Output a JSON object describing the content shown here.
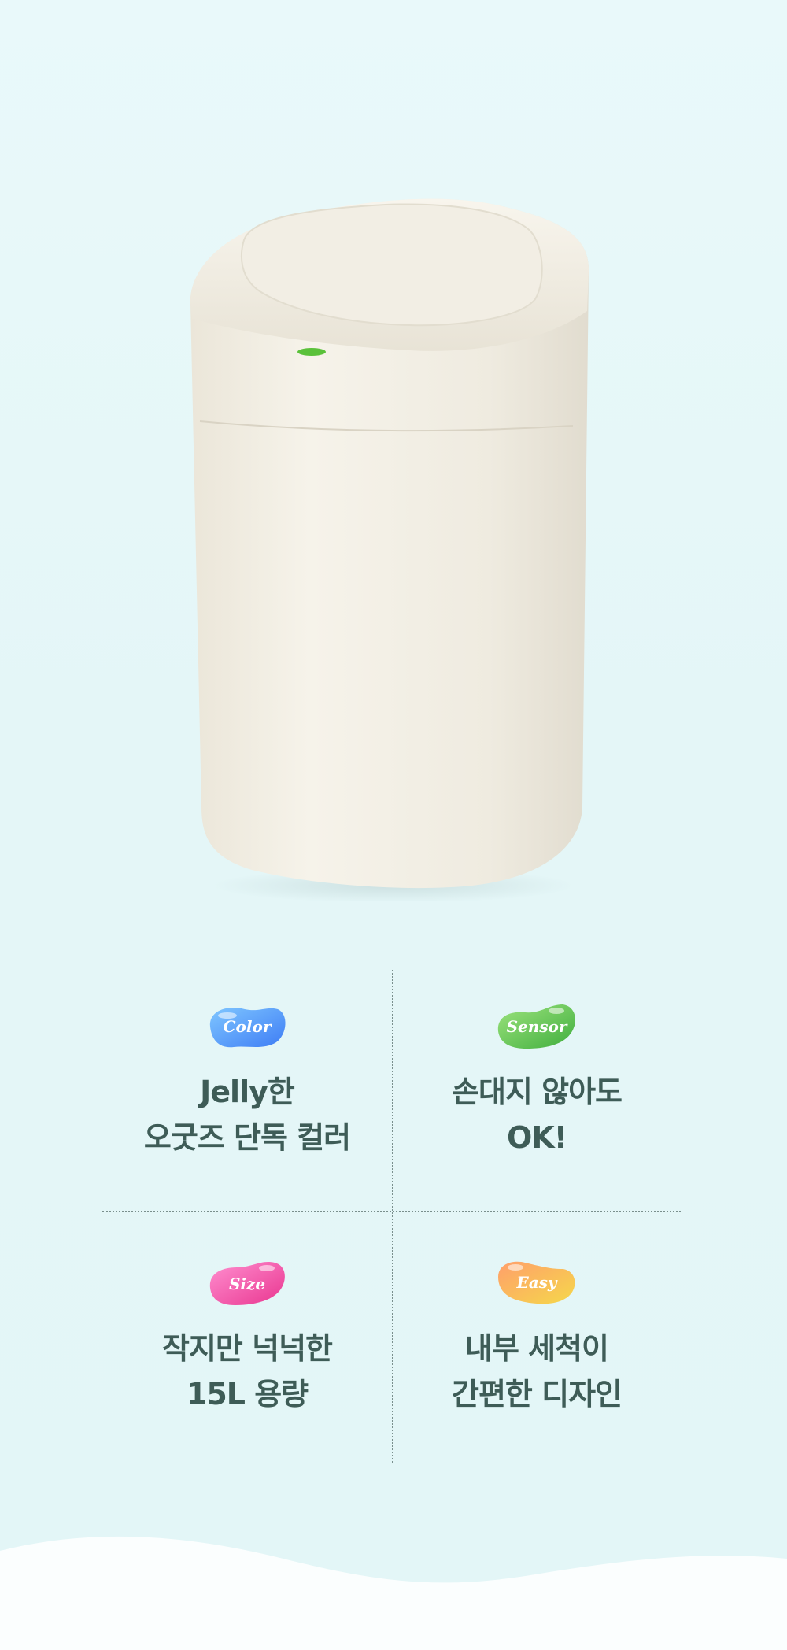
{
  "features": [
    {
      "badge": "Color",
      "badge_icon": "blue-jellybean-icon",
      "line1": "Jelly한",
      "line2": "오굿즈 단독 컬러"
    },
    {
      "badge": "Sensor",
      "badge_icon": "green-jellybean-icon",
      "line1": "손대지 않아도",
      "line2": "OK!"
    },
    {
      "badge": "Size",
      "badge_icon": "pink-jellybean-icon",
      "line1": "작지만 넉넉한",
      "line2": "15L 용량"
    },
    {
      "badge": "Easy",
      "badge_icon": "yellow-orange-jellybean-icon",
      "line1": "내부 세척이",
      "line2": "간편한 디자인"
    }
  ],
  "colors": {
    "background": "#e6f7f8",
    "title_text": "#3e5c57",
    "product_body": "#f1ede2",
    "sensor_light": "#5ac13a",
    "divider": "#7a8f8d"
  }
}
